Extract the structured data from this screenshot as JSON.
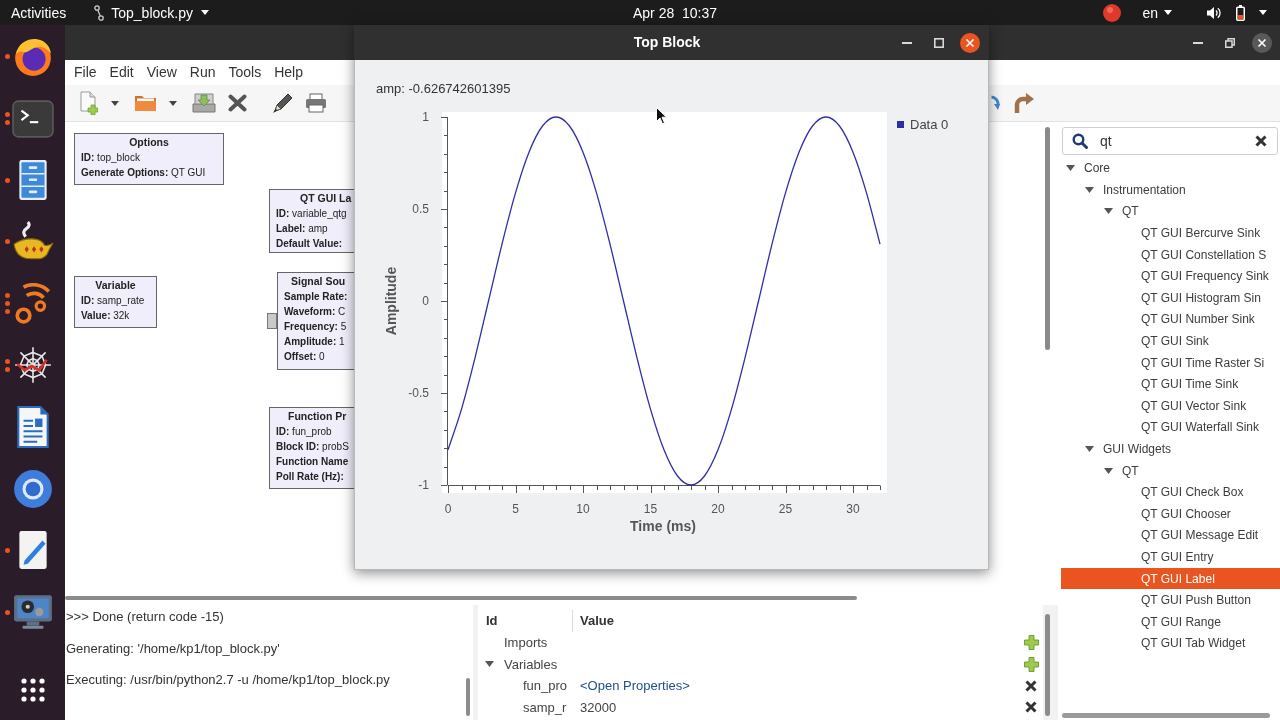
{
  "top_bar": {
    "activities": "Activities",
    "app_menu": "Top_block.py",
    "clock": "Apr 28  10:37",
    "keyboard_layout": "en"
  },
  "dock": [
    {
      "kind": "browser",
      "windows": [
        {
          "open": true
        }
      ]
    },
    {
      "kind": "terminal",
      "windows": [
        {
          "open": true
        },
        {
          "open": true
        }
      ]
    },
    {
      "kind": "files",
      "windows": [
        {
          "open": true
        }
      ]
    },
    {
      "kind": "lamp",
      "windows": [
        {
          "open": true
        }
      ]
    },
    {
      "kind": "waves",
      "windows": [
        {
          "open": true
        },
        {
          "open": true
        },
        {
          "open": true
        }
      ]
    },
    {
      "kind": "web",
      "windows": [
        {
          "open": true
        },
        {
          "open": true
        }
      ]
    },
    {
      "kind": "document"
    },
    {
      "kind": "ring"
    },
    {
      "kind": "editor",
      "windows": [
        {
          "open": true
        }
      ]
    },
    {
      "kind": "video",
      "windows": [
        {
          "open": true
        }
      ]
    },
    {
      "kind": "apps"
    }
  ],
  "menu_bar": [
    "File",
    "Edit",
    "View",
    "Run",
    "Tools",
    "Help"
  ],
  "flowgraph": {
    "blocks": [
      {
        "title": "Options",
        "port": false,
        "params": [
          {
            "label": "ID:",
            "value": "top_block"
          },
          {
            "label": "Generate Options:",
            "value": "QT GUI"
          }
        ]
      },
      {
        "title": "QT GUI La",
        "port": false,
        "params": [
          {
            "label": "ID:",
            "value": "variable_qtg"
          },
          {
            "label": "Label:",
            "value": "amp"
          },
          {
            "label": "Default Value:"
          }
        ]
      },
      {
        "title": "Variable",
        "port": false,
        "params": [
          {
            "label": "ID:",
            "value": "samp_rate"
          },
          {
            "label": "Value:",
            "value": "32k"
          }
        ]
      },
      {
        "title": "Signal Sou",
        "port": true,
        "params": [
          {
            "label": "Sample Rate:"
          },
          {
            "label": "Waveform:",
            "value": "C"
          },
          {
            "label": "Frequency:",
            "value": "5"
          },
          {
            "label": "Amplitude:",
            "value": "1"
          },
          {
            "label": "Offset:",
            "value": "0"
          }
        ]
      },
      {
        "title": "Function Pr",
        "port": false,
        "params": [
          {
            "label": "ID:",
            "value": "fun_prob"
          },
          {
            "label": "Block ID:",
            "value": "probS"
          },
          {
            "label": "Function Name"
          },
          {
            "label": "Poll Rate (Hz):"
          }
        ]
      }
    ]
  },
  "console": {
    "lines": [
      ">>> Done (return code -15)",
      "Generating: '/home/kp1/top_block.py'",
      "Executing: /usr/bin/python2.7 -u /home/kp1/top_block.py"
    ]
  },
  "variables": {
    "columns": [
      "Id",
      "Value"
    ],
    "rows": [
      {
        "id": "Imports"
      },
      {
        "id": "Variables",
        "expanded": true,
        "children": [
          {
            "id": "fun_pro",
            "value": "<Open Properties>",
            "kind": "link"
          },
          {
            "id": "samp_r",
            "value": "32000",
            "kind": "plain"
          }
        ]
      }
    ]
  },
  "block_library": {
    "search": {
      "value": "qt"
    },
    "tree": [
      {
        "label": "Core",
        "expanded": true,
        "selected": false,
        "children": [
          {
            "label": "Instrumentation",
            "expanded": true,
            "selected": false,
            "children": [
              {
                "label": "QT",
                "expanded": true,
                "selected": false,
                "children": [
                  {
                    "label": "QT GUI Bercurve Sink",
                    "selected": false
                  },
                  {
                    "label": "QT GUI Constellation S",
                    "selected": false
                  },
                  {
                    "label": "QT GUI Frequency Sink",
                    "selected": false
                  },
                  {
                    "label": "QT GUI Histogram Sin",
                    "selected": false
                  },
                  {
                    "label": "QT GUI Number Sink",
                    "selected": false
                  },
                  {
                    "label": "QT GUI Sink",
                    "selected": false
                  },
                  {
                    "label": "QT GUI Time Raster Si",
                    "selected": false
                  },
                  {
                    "label": "QT GUI Time Sink",
                    "selected": false
                  },
                  {
                    "label": "QT GUI Vector Sink",
                    "selected": false
                  },
                  {
                    "label": "QT GUI Waterfall Sink",
                    "selected": false
                  }
                ]
              }
            ]
          },
          {
            "label": "GUI Widgets",
            "expanded": true,
            "selected": false,
            "children": [
              {
                "label": "QT",
                "expanded": true,
                "selected": false,
                "children": [
                  {
                    "label": "QT GUI Check Box",
                    "selected": false
                  },
                  {
                    "label": "QT GUI Chooser",
                    "selected": false
                  },
                  {
                    "label": "QT GUI Message Edit",
                    "selected": false
                  },
                  {
                    "label": "QT GUI Entry",
                    "selected": false
                  },
                  {
                    "label": "QT GUI Label",
                    "selected": true
                  },
                  {
                    "label": "QT GUI Push Button",
                    "selected": false
                  },
                  {
                    "label": "QT GUI Range",
                    "selected": false
                  },
                  {
                    "label": "QT GUI Tab Widget",
                    "selected": false
                  }
                ]
              }
            ]
          }
        ]
      }
    ]
  },
  "top_block_window": {
    "title": "Top Block",
    "label": "amp: -0.626742601395",
    "chart_data": {
      "type": "line",
      "xlabel": "Time (ms)",
      "ylabel": "Amplitude",
      "x": [
        0,
        1,
        2,
        3,
        4,
        5,
        6,
        7,
        8,
        9,
        10,
        11,
        12,
        13,
        14,
        15,
        16,
        17,
        18,
        19,
        20,
        21,
        22,
        23,
        24,
        25,
        26,
        27,
        28,
        29,
        30,
        31,
        32
      ],
      "series": [
        {
          "name": "Data 0",
          "color": "#2e2ea8",
          "values": [
            -0.809,
            -0.588,
            -0.309,
            0,
            0.309,
            0.588,
            0.809,
            0.951,
            1,
            0.951,
            0.809,
            0.588,
            0.309,
            0,
            -0.309,
            -0.588,
            -0.809,
            -0.951,
            -1,
            -0.951,
            -0.809,
            -0.588,
            -0.309,
            0,
            0.309,
            0.588,
            0.809,
            0.951,
            1,
            0.951,
            0.809,
            0.588,
            0.309
          ]
        }
      ],
      "xlim": [
        0,
        32
      ],
      "ylim": [
        -1,
        1
      ],
      "xticks": [
        0,
        5,
        10,
        15,
        20,
        25,
        30
      ],
      "yticks": [
        -1,
        -0.5,
        0,
        0.5,
        1
      ]
    }
  }
}
